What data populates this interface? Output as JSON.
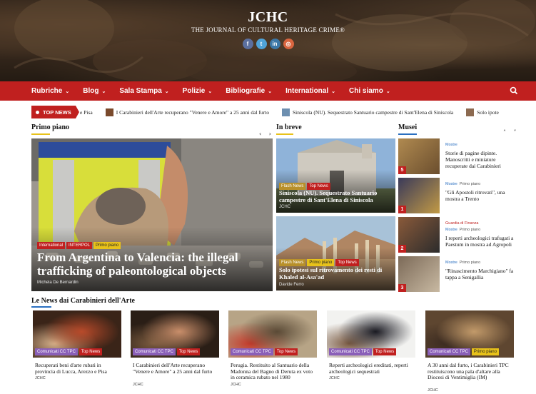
{
  "header": {
    "title": "JCHC",
    "subtitle": "THE JOURNAL OF CULTURAL HERITAGE CRIME®",
    "socials": [
      {
        "icon": "facebook-icon",
        "glyph": "f",
        "color": "#5b6f9e"
      },
      {
        "icon": "twitter-icon",
        "glyph": "t",
        "color": "#4fa3d8"
      },
      {
        "icon": "linkedin-icon",
        "glyph": "in",
        "color": "#3c78a8"
      },
      {
        "icon": "instagram-icon",
        "glyph": "◎",
        "color": "#d9653f"
      }
    ]
  },
  "nav": {
    "items": [
      "Rubriche",
      "Blog",
      "Sala Stampa",
      "Polizie",
      "Bibliografie",
      "International",
      "Chi siamo"
    ],
    "chevron": "⌄",
    "search_icon": "search-icon"
  },
  "ticker": {
    "label": "TOP NEWS",
    "items": [
      "e Pisa",
      "I Carabinieri dell'Arte recuperano \"Venere e Amore\" a 25 anni dal furto",
      "Siniscola (NU). Sequestrato Santuario campestre di Sant'Elena di Siniscola",
      "Solo ipote"
    ]
  },
  "primo_piano": {
    "heading": "Primo piano",
    "arrows": "‹ ›",
    "tags": [
      {
        "label": "International",
        "color": "#c0201f"
      },
      {
        "label": "INTERPOL",
        "color": "#c0201f"
      },
      {
        "label": "Primo piano",
        "color": "#e8c21a"
      }
    ],
    "title": "From Argentina to Valencia: the illegal trafficking of paleontological objects",
    "author": "Michela De Bernardin"
  },
  "in_breve": {
    "heading": "In breve",
    "items": [
      {
        "tags": [
          {
            "label": "Flash News",
            "color": "#b8902a"
          },
          {
            "label": "Top News",
            "color": "#c0201f"
          }
        ],
        "title": "Siniscola (NU). Sequestrato Santuario campestre di Sant'Elena di Siniscola",
        "author": "JCHC"
      },
      {
        "tags": [
          {
            "label": "Flash News",
            "color": "#b8902a"
          },
          {
            "label": "Primo piano",
            "color": "#e8c21a"
          },
          {
            "label": "Top News",
            "color": "#c0201f"
          }
        ],
        "title": "Solo ipotesi sul ritrovamento dei resti di Khaled al-Asa'ad",
        "author": "Davide Ferro"
      }
    ]
  },
  "musei": {
    "heading": "Musei",
    "arrows": "˄ ˅",
    "items": [
      {
        "num": "5",
        "cats": [
          {
            "label": "Mostre",
            "color": "#2a6fc0"
          }
        ],
        "title": "Storie di pagine dipinte. Manoscritti e miniature recuperate dai Carabinieri"
      },
      {
        "num": "1",
        "cats": [
          {
            "label": "Mostre",
            "color": "#2a6fc0"
          },
          {
            "label": "Primo piano",
            "color": "#555555"
          }
        ],
        "title": "\"Gli Apostoli ritrovati\", una mostra a Trento"
      },
      {
        "num": "2",
        "cats": [
          {
            "label": "Guardia di Finanza",
            "color": "#c0201f"
          },
          {
            "label": "Mostre",
            "color": "#2a6fc0"
          },
          {
            "label": "Primo piano",
            "color": "#555555"
          }
        ],
        "title": "I reperti archeologici trafugati a Paestum in mostra ad Agropoli"
      },
      {
        "num": "3",
        "cats": [
          {
            "label": "Mostre",
            "color": "#2a6fc0"
          },
          {
            "label": "Primo piano",
            "color": "#555555"
          }
        ],
        "title": "\"Rinascimento Marchigiano\" fa tappa a Senigallia"
      }
    ]
  },
  "carabinieri": {
    "heading": "Le News dai Carabinieri dell'Arte",
    "items": [
      {
        "tags": [
          {
            "label": "Comunicati CC TPC",
            "color": "#8a5fb8"
          },
          {
            "label": "Top News",
            "color": "#c0201f"
          }
        ],
        "title": "Recuperati beni d'arte rubati in provincia di Lucca, Arezzo e Pisa",
        "author": "JCHC"
      },
      {
        "tags": [
          {
            "label": "Comunicati CC TPC",
            "color": "#8a5fb8"
          },
          {
            "label": "Top News",
            "color": "#c0201f"
          }
        ],
        "title": "I Carabinieri dell'Arte recuperano \"Venere e Amore\" a 25 anni dal furto",
        "author": "JCHC"
      },
      {
        "tags": [
          {
            "label": "Comunicati CC TPC",
            "color": "#8a5fb8"
          },
          {
            "label": "Top News",
            "color": "#c0201f"
          }
        ],
        "title": "Perugia. Restituito al Santuario della Madonna del Bagno di Deruta ex voto in ceramica rubato nel 1980",
        "author": "JCHC"
      },
      {
        "tags": [
          {
            "label": "Comunicati CC TPC",
            "color": "#8a5fb8"
          },
          {
            "label": "Top News",
            "color": "#c0201f"
          }
        ],
        "title": "Reperti archeologici ereditati, reperti archeologici sequestrati",
        "author": "JCHC"
      },
      {
        "tags": [
          {
            "label": "Comunicati CC TPC",
            "color": "#8a5fb8"
          },
          {
            "label": "Primo piano",
            "color": "#e8c21a"
          }
        ],
        "title": "A 30 anni dal furto, i Carabinieri TPC restituiscono una pala d'altare alla Diocesi di Ventimiglia (IM)",
        "author": "JCHC"
      }
    ]
  },
  "colors": {
    "brand_red": "#c0201f",
    "accent_yellow": "#e8c21a",
    "accent_blue": "#2a6fc0",
    "accent_purple": "#8a5fb8"
  }
}
